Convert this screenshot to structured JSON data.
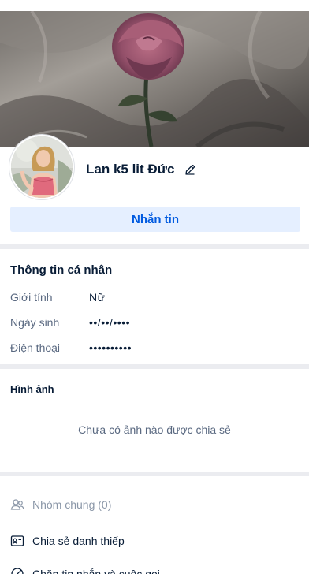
{
  "profile": {
    "name": "Lan k5 lit Đức",
    "message_label": "Nhắn tin"
  },
  "personal_info": {
    "title": "Thông tin cá nhân",
    "rows": [
      {
        "label": "Giới tính",
        "value": "Nữ"
      },
      {
        "label": "Ngày sinh",
        "value": "••/••/••••"
      },
      {
        "label": "Điện thoại",
        "value": "••••••••••"
      }
    ]
  },
  "photos": {
    "title": "Hình ảnh",
    "empty_text": "Chưa có ảnh nào được chia sẻ"
  },
  "actions": [
    {
      "label": "Nhóm chung (0)",
      "icon": "group-icon",
      "enabled": false
    },
    {
      "label": "Chia sẻ danh thiếp",
      "icon": "contact-card-icon",
      "enabled": true
    },
    {
      "label": "Chặn tin nhắn và cuộc gọi",
      "icon": "block-icon",
      "enabled": true
    }
  ],
  "colors": {
    "accent": "#005ae0",
    "button_bg": "#e5efff",
    "divider": "#ebecf0",
    "label": "#5a6981",
    "text": "#081c36"
  }
}
